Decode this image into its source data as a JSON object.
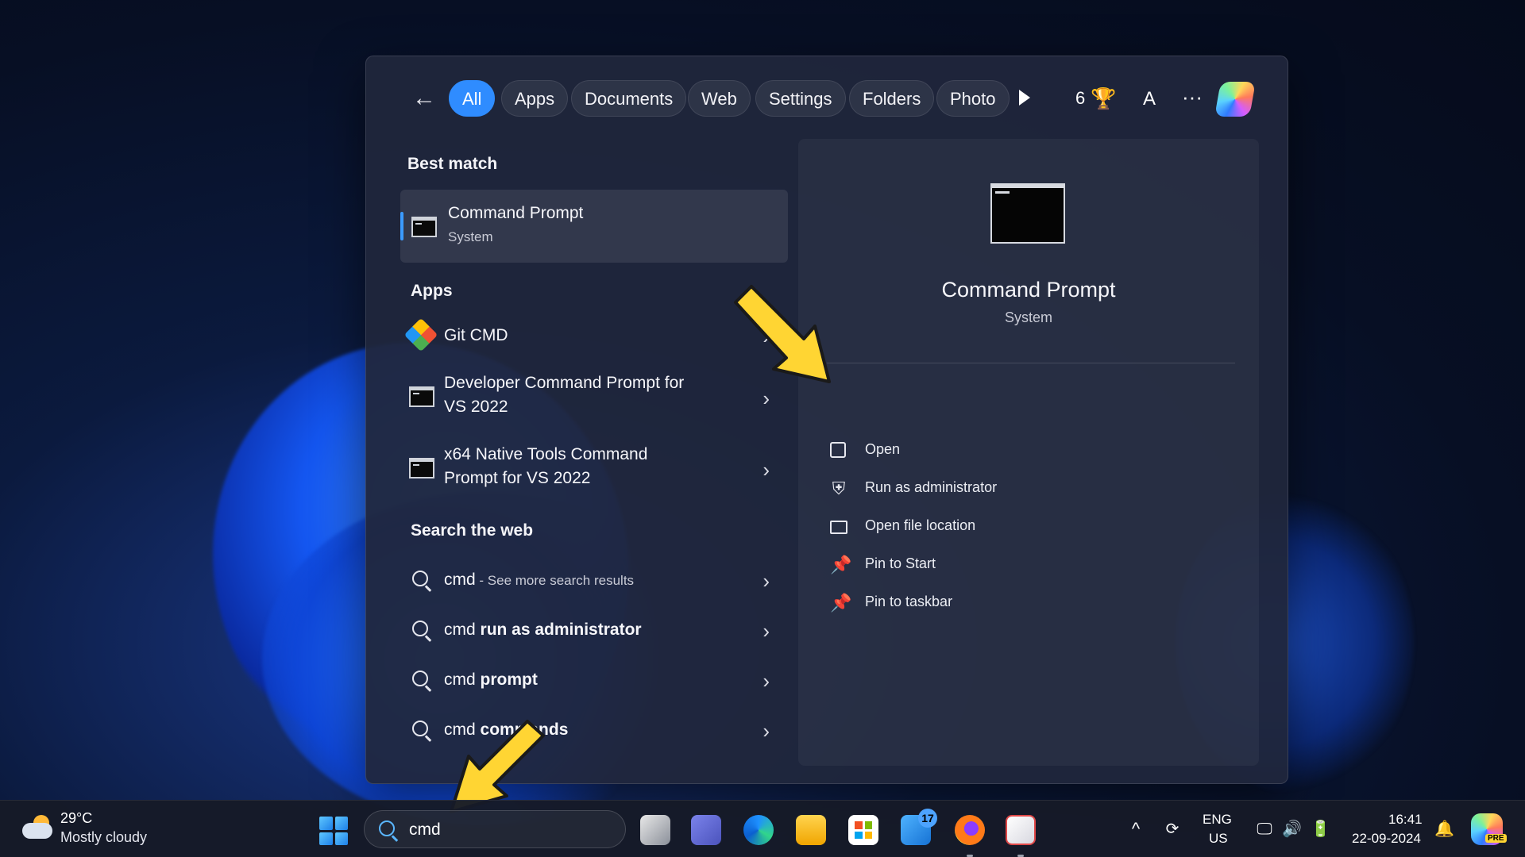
{
  "filters": {
    "back_label": "←",
    "chips": [
      "All",
      "Apps",
      "Documents",
      "Web",
      "Settings",
      "Folders",
      "Photo"
    ],
    "points": "6",
    "avatar_letter": "A",
    "more_label": "···"
  },
  "best_match": {
    "heading": "Best match",
    "title": "Command Prompt",
    "subtitle": "System"
  },
  "apps": {
    "heading": "Apps",
    "items": [
      {
        "line1": "Git CMD",
        "line2": ""
      },
      {
        "line1": "Developer Command Prompt for",
        "line2": "VS 2022"
      },
      {
        "line1": "x64 Native Tools Command",
        "line2": "Prompt for VS 2022"
      }
    ]
  },
  "web": {
    "heading": "Search the web",
    "items": [
      {
        "query": "cmd",
        "suffix": " - See more search results"
      },
      {
        "query": "cmd",
        "bold": " run as administrator"
      },
      {
        "query": "cmd",
        "bold": " prompt"
      },
      {
        "query": "cmd",
        "bold": " commands"
      }
    ]
  },
  "detail": {
    "title": "Command Prompt",
    "subtitle": "System",
    "actions": [
      {
        "label": "Open",
        "icon": "open-external-icon"
      },
      {
        "label": "Run as administrator",
        "icon": "shield-admin-icon"
      },
      {
        "label": "Open file location",
        "icon": "folder-icon"
      },
      {
        "label": "Pin to Start",
        "icon": "pin-icon"
      },
      {
        "label": "Pin to taskbar",
        "icon": "pin-icon"
      }
    ]
  },
  "taskbar": {
    "temperature": "29°C",
    "condition": "Mostly cloudy",
    "search_query": "cmd",
    "mail_badge": "17",
    "language_line1": "ENG",
    "language_line2": "US",
    "time": "16:41",
    "date": "22-09-2024",
    "copilot_badge": "PRE"
  },
  "colors": {
    "accent": "#2f8cff",
    "arrow": "#ffd533"
  }
}
